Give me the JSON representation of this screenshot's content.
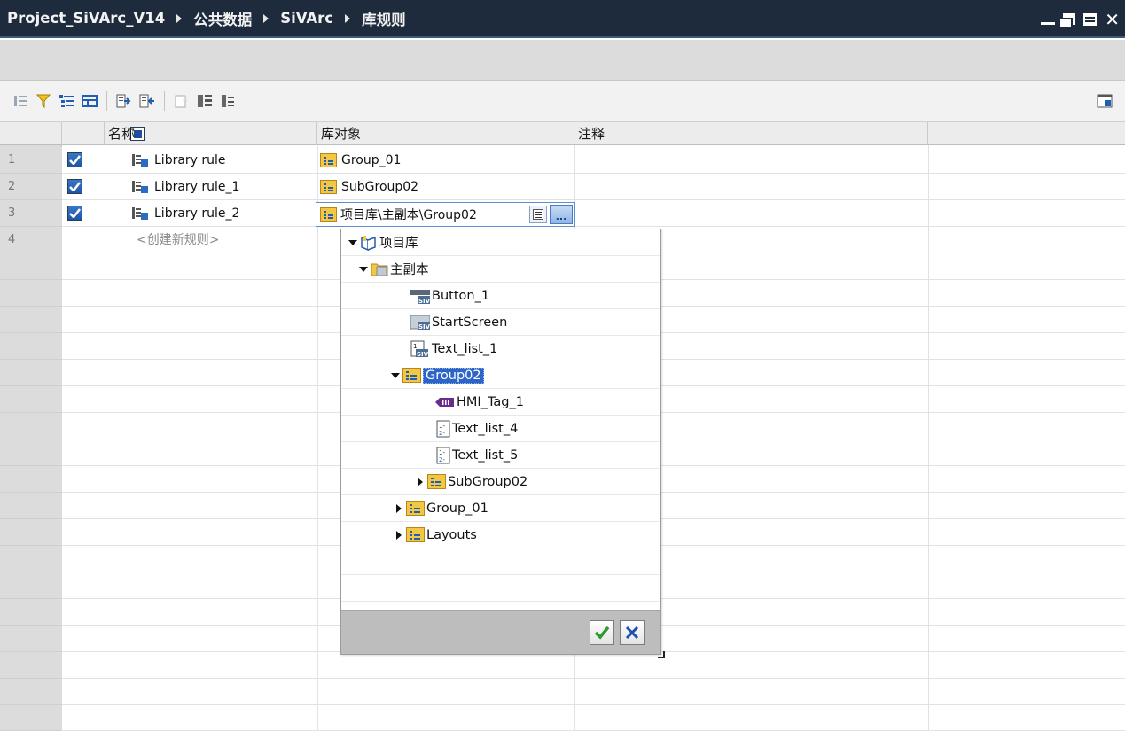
{
  "breadcrumb": [
    "Project_SiVArc_V14",
    "公共数据",
    "SiVArc",
    "库规则"
  ],
  "columns": {
    "name": "名称",
    "library_object": "库对象",
    "comment": "注释"
  },
  "rows": [
    {
      "num": "1",
      "name": "Library rule",
      "library_object": "Group_01",
      "checked": true
    },
    {
      "num": "2",
      "name": "Library rule_1",
      "library_object": "SubGroup02",
      "checked": true
    },
    {
      "num": "3",
      "name": "Library rule_2",
      "library_object": "项目库\\主副本\\Group02",
      "checked": true
    },
    {
      "num": "4",
      "name": "<创建新规则>"
    }
  ],
  "edit_button_label": "...",
  "tree": [
    {
      "label": "项目库",
      "icon": "project-library-icon",
      "expanded": true,
      "depth": 0
    },
    {
      "label": "主副本",
      "icon": "master-copies-folder-icon",
      "expanded": true,
      "depth": 1
    },
    {
      "label": "Button_1",
      "icon": "siv-button-icon",
      "depth": 2
    },
    {
      "label": "StartScreen",
      "icon": "siv-screen-icon",
      "depth": 2
    },
    {
      "label": "Text_list_1",
      "icon": "siv-textlist-icon",
      "depth": 2
    },
    {
      "label": "Group02",
      "icon": "group-folder-icon",
      "expanded": true,
      "selected": true,
      "depth": 2
    },
    {
      "label": "HMI_Tag_1",
      "icon": "hmi-tag-icon",
      "depth": 3
    },
    {
      "label": "Text_list_4",
      "icon": "textlist-icon",
      "depth": 3
    },
    {
      "label": "Text_list_5",
      "icon": "textlist-icon",
      "depth": 3
    },
    {
      "label": "SubGroup02",
      "icon": "group-folder-icon",
      "collapsed": true,
      "depth": 3
    },
    {
      "label": "Group_01",
      "icon": "group-folder-icon",
      "collapsed": true,
      "depth": 2
    },
    {
      "label": "Layouts",
      "icon": "group-folder-icon",
      "collapsed": true,
      "depth": 2
    }
  ],
  "colors": {
    "titlebar": "#1d2b3d",
    "selection": "#2c64c8",
    "checkbox": "#1f55a6"
  }
}
